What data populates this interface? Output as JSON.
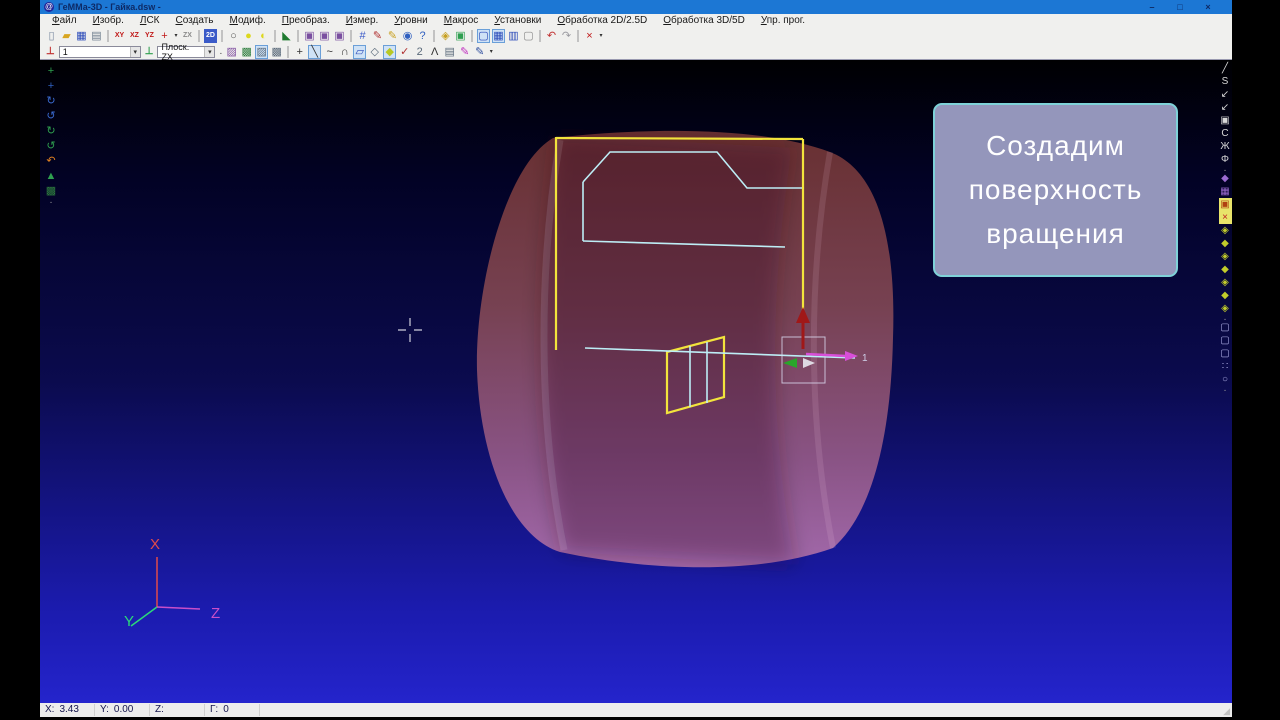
{
  "window": {
    "title": "ГеММа-3D - Гайка.dsw -",
    "app_icon_glyph": "@",
    "minimize": "–",
    "maximize": "□",
    "close": "×"
  },
  "menu": {
    "items": [
      {
        "name": "menu-file",
        "label": "Файл"
      },
      {
        "name": "menu-image",
        "label": "Изобр."
      },
      {
        "name": "menu-lcs",
        "label": "ЛСК"
      },
      {
        "name": "menu-create",
        "label": "Создать"
      },
      {
        "name": "menu-modify",
        "label": "Модиф."
      },
      {
        "name": "menu-transform",
        "label": "Преобраз."
      },
      {
        "name": "menu-measure",
        "label": "Измер."
      },
      {
        "name": "menu-levels",
        "label": "Уровни"
      },
      {
        "name": "menu-macro",
        "label": "Макрос"
      },
      {
        "name": "menu-settings",
        "label": "Установки"
      },
      {
        "name": "menu-machining-2d",
        "label": "Обработка 2D/2.5D"
      },
      {
        "name": "menu-machining-3d",
        "label": "Обработка 3D/5D"
      },
      {
        "name": "menu-programs",
        "label": "Упр. прог."
      }
    ]
  },
  "toolbar1": {
    "items": [
      {
        "name": "new-file-icon",
        "glyph": "▯",
        "color": "#7a8aa0"
      },
      {
        "name": "open-file-icon",
        "glyph": "▰",
        "color": "#d8a520"
      },
      {
        "name": "save-file-icon",
        "glyph": "▦",
        "color": "#2848b8"
      },
      {
        "name": "print-icon",
        "glyph": "▤",
        "color": "#6a7a8a"
      },
      {
        "type": "sep"
      },
      {
        "name": "view-xy-button",
        "glyph": "XY",
        "color": "#c01818"
      },
      {
        "name": "view-xz-button",
        "glyph": "XZ",
        "color": "#c01818"
      },
      {
        "name": "view-yz-button",
        "glyph": "YZ",
        "color": "#c01818"
      },
      {
        "name": "view-axonometry-button",
        "glyph": "+",
        "color": "#c01818"
      },
      {
        "name": "view-axonometry-dropdown",
        "type": "dd",
        "glyph": "▾"
      },
      {
        "name": "view-zx-button",
        "glyph": "ZX",
        "color": "#8a8a8a"
      },
      {
        "type": "sep"
      },
      {
        "name": "view-2d-button",
        "glyph": "2D",
        "color": "#ffffff",
        "bg": "#3b5bc8"
      },
      {
        "type": "sep"
      },
      {
        "name": "circle-outline-icon",
        "glyph": "○",
        "color": "#555555"
      },
      {
        "name": "circle-filled-icon",
        "glyph": "●",
        "color": "#ddd81e"
      },
      {
        "name": "circle-half-icon",
        "glyph": "◐",
        "color": "#ddd81e"
      },
      {
        "type": "sep"
      },
      {
        "name": "arrow-green-icon",
        "glyph": "◣",
        "color": "#1f7a2f"
      },
      {
        "type": "sep"
      },
      {
        "name": "viewport-1-icon",
        "glyph": "▣",
        "color": "#7a4fa0"
      },
      {
        "name": "viewport-2-icon",
        "glyph": "▣",
        "color": "#7a4fa0"
      },
      {
        "name": "viewport-3-icon",
        "glyph": "▣",
        "color": "#7a4fa0"
      },
      {
        "type": "sep"
      },
      {
        "name": "grid-icon",
        "glyph": "#",
        "color": "#3b5bc8"
      },
      {
        "name": "edit-red-pencil-icon",
        "glyph": "✎",
        "color": "#b03030"
      },
      {
        "name": "edit-yellow-pencil-icon",
        "glyph": "✎",
        "color": "#c8a020"
      },
      {
        "name": "eye-icon",
        "glyph": "◉",
        "color": "#3060c0"
      },
      {
        "name": "help-icon",
        "glyph": "?",
        "color": "#3060c0"
      },
      {
        "type": "sep"
      },
      {
        "name": "palette-icon",
        "glyph": "◈",
        "color": "#c8a020"
      },
      {
        "name": "screen-icon",
        "glyph": "▣",
        "color": "#2f9f50"
      },
      {
        "type": "sep"
      },
      {
        "name": "window-single-icon",
        "glyph": "▢",
        "color": "#2848b8",
        "pressed": true
      },
      {
        "name": "window-cascade-icon",
        "glyph": "▦",
        "color": "#2848b8",
        "pressed": true
      },
      {
        "name": "window-tile-icon",
        "glyph": "▥",
        "color": "#2848b8"
      },
      {
        "name": "window-small-icon",
        "glyph": "▢",
        "color": "#8a8a8a"
      },
      {
        "type": "sep"
      },
      {
        "name": "undo-icon",
        "glyph": "↶",
        "color": "#c03030"
      },
      {
        "name": "redo-icon",
        "glyph": "↷",
        "color": "#9a9aa0"
      },
      {
        "type": "sep"
      },
      {
        "name": "delete-icon",
        "glyph": "×",
        "color": "#c01818"
      },
      {
        "name": "toolbar1-more-icon",
        "type": "dd",
        "glyph": "▾"
      }
    ]
  },
  "toolbar2": {
    "ucs_icon": {
      "glyph": "⊥",
      "color": "#c03030"
    },
    "ucs_value": "1",
    "plane_icon": {
      "glyph": "⊥",
      "color": "#2f9f4f"
    },
    "plane_value": "Плоск. ZX",
    "combo_arrow": "▾",
    "items": [
      {
        "name": "toolbar2-overflow-dot",
        "type": "dot",
        "glyph": "."
      },
      {
        "name": "hatch-pen-icon",
        "glyph": "▨",
        "color": "#8050a0"
      },
      {
        "name": "region-fill-icon",
        "glyph": "▩",
        "color": "#2f7f3f"
      },
      {
        "name": "hatch-style-icon",
        "glyph": "▨",
        "color": "#5a6a7a",
        "pressed": true
      },
      {
        "name": "hatch-style-2-icon",
        "glyph": "▩",
        "color": "#5a6a7a"
      },
      {
        "type": "sep"
      },
      {
        "name": "point-tool-icon",
        "glyph": "+",
        "color": "#333333"
      },
      {
        "name": "line-tool-icon",
        "glyph": "╲",
        "color": "#333333",
        "pressed": true
      },
      {
        "name": "curve-tool-icon",
        "glyph": "~",
        "color": "#333333"
      },
      {
        "name": "arc-tool-icon",
        "glyph": "∩",
        "color": "#333333"
      },
      {
        "name": "plane-tool-icon",
        "glyph": "▱",
        "color": "#2848b8",
        "pressed": true
      },
      {
        "name": "contour-tool-icon",
        "glyph": "◇",
        "color": "#5a6a7a"
      },
      {
        "name": "region-tool-icon",
        "glyph": "◆",
        "color": "#b8c825",
        "pressed": true
      },
      {
        "name": "snap-tool-icon",
        "glyph": "✓",
        "color": "#b03030"
      },
      {
        "name": "spline2-tool-icon",
        "glyph": "2",
        "color": "#5a6a7a"
      },
      {
        "name": "vertex-tool-icon",
        "glyph": "Λ",
        "color": "#333333"
      },
      {
        "name": "mesh-tool-icon",
        "glyph": "▤",
        "color": "#5a6a7a"
      },
      {
        "name": "magenta-pen-icon",
        "glyph": "✎",
        "color": "#c030c0"
      },
      {
        "name": "blue-pen-icon",
        "glyph": "✎",
        "color": "#3050a0"
      },
      {
        "name": "toolbar2-more-icon",
        "type": "dd",
        "glyph": "▾"
      }
    ]
  },
  "left_toolbar": {
    "items": [
      {
        "name": "zoom-pan-icon",
        "glyph": "+",
        "color": "#2fa04f"
      },
      {
        "name": "zoom-window-icon",
        "glyph": "+",
        "color": "#3060c0"
      },
      {
        "name": "rotate-view-icon",
        "glyph": "↻",
        "color": "#3a6ad0"
      },
      {
        "name": "rotate-view-2-icon",
        "glyph": "↺",
        "color": "#3a6ad0"
      },
      {
        "name": "orbit-icon",
        "glyph": "↻",
        "color": "#2fa04f"
      },
      {
        "name": "orbit-2-icon",
        "glyph": "↺",
        "color": "#2fa04f"
      },
      {
        "name": "view-restore-icon",
        "glyph": "↶",
        "color": "#e08020"
      },
      {
        "name": "shading-icon",
        "glyph": "▲",
        "color": "#2fa04f"
      },
      {
        "name": "render-mode-icon",
        "glyph": "▩",
        "color": "#2f7f3f"
      },
      {
        "name": "left-toolbar-more-icon",
        "type": "dot",
        "glyph": "."
      }
    ]
  },
  "right_toolbar": {
    "items": [
      {
        "name": "line-surf-icon",
        "glyph": "╱",
        "color": "#d8d8d8"
      },
      {
        "name": "spline-surf-icon",
        "glyph": "S",
        "color": "#d8d8d8"
      },
      {
        "name": "project-1-icon",
        "glyph": "↙",
        "color": "#d8d8d8"
      },
      {
        "name": "project-2-icon",
        "glyph": "↙",
        "color": "#d8d8d8"
      },
      {
        "name": "rect-surf-icon",
        "glyph": "▣",
        "color": "#d8d8d8"
      },
      {
        "name": "arc-surf-icon",
        "glyph": "C",
        "color": "#d8d8d8"
      },
      {
        "name": "wave-surf-icon",
        "glyph": "Ж",
        "color": "#d8d8d8"
      },
      {
        "name": "pipe-surf-icon",
        "glyph": "Φ",
        "color": "#d8d8d8"
      },
      {
        "name": "right-dot-1",
        "type": "dot",
        "glyph": "."
      },
      {
        "name": "mesh-purple-icon",
        "glyph": "◆",
        "color": "#9a6ad0"
      },
      {
        "name": "grid-purple-icon",
        "glyph": "▦",
        "color": "#9a6ad0"
      },
      {
        "name": "sun-icon",
        "glyph": "▣",
        "color": "#b04010",
        "bg": "#e8e46a"
      },
      {
        "name": "cut-red-icon",
        "glyph": "×",
        "color": "#c02020",
        "bg": "#e8e46a"
      },
      {
        "name": "surface-revolve-icon",
        "glyph": "◈",
        "color": "#c2cc2a"
      },
      {
        "name": "surface-ruled-icon",
        "glyph": "◆",
        "color": "#c2cc2a"
      },
      {
        "name": "surface-kinematic-icon",
        "glyph": "◈",
        "color": "#c2cc2a"
      },
      {
        "name": "surface-mesh-icon",
        "glyph": "◆",
        "color": "#c2cc2a"
      },
      {
        "name": "surface-patch-icon",
        "glyph": "◈",
        "color": "#c2cc2a"
      },
      {
        "name": "surface-fillet-icon",
        "glyph": "◆",
        "color": "#c2cc2a"
      },
      {
        "name": "surface-offset-icon",
        "glyph": "◈",
        "color": "#c2cc2a"
      },
      {
        "name": "right-dot-2",
        "type": "dot",
        "glyph": "."
      },
      {
        "name": "box-1-icon",
        "glyph": "▢",
        "color": "#a8a8e0"
      },
      {
        "name": "box-2-icon",
        "glyph": "▢",
        "color": "#a8a8e0"
      },
      {
        "name": "box-3-icon",
        "glyph": "▢",
        "color": "#a8a8e0"
      },
      {
        "name": "group-icon",
        "glyph": "∷",
        "color": "#a8a8e0"
      },
      {
        "name": "circle-surf-icon",
        "glyph": "○",
        "color": "#a8a8e0"
      },
      {
        "name": "right-dot-3",
        "type": "dot",
        "glyph": "."
      }
    ]
  },
  "viewport": {
    "overlay": {
      "line1": "Создадим",
      "line2": "поверхность",
      "line3": "вращения",
      "bg": "#9496bb",
      "border_color": "#7fd2d8",
      "text_color": "#ffffff"
    },
    "axes": {
      "x_label": "X",
      "y_label": "Y",
      "z_label": "Z",
      "x_color": "#e14b4b",
      "y_color": "#2bd87a",
      "z_color": "#c94fc9"
    },
    "marker_label": "1",
    "colors": {
      "bg_top": "#000002",
      "bg_mid": "#0b0b4e",
      "bg_bottom": "#2424cc",
      "cylinder_top": "#6b3132",
      "cylinder_mid1": "#7a4352",
      "cylinder_mid2": "#8d5585",
      "cylinder_bottom": "#a66bab",
      "profile_yellow": "#f2e43c",
      "profile_cyan": "#bdeef6",
      "arrow_red": "#a01818",
      "arrow_magenta": "#d84fd8",
      "arrow_green": "#2aa62a",
      "select_box": "#dcdcf2",
      "crosshair": "#cfcfdc"
    }
  },
  "status_bar": {
    "fields": [
      {
        "label": "X:",
        "value": "3.43"
      },
      {
        "label": "Y:",
        "value": "0.00"
      },
      {
        "label": "Z:",
        "value": ""
      },
      {
        "label": "Г:",
        "value": "0"
      }
    ],
    "grip_glyph": "◢"
  }
}
